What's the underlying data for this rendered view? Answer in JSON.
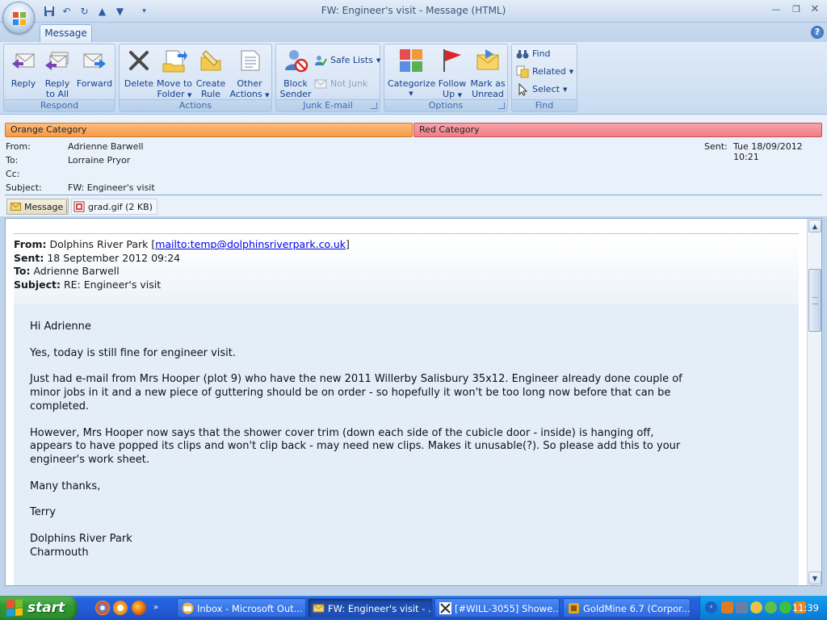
{
  "window": {
    "title": "FW: Engineer's visit - Message (HTML)"
  },
  "tabs": [
    {
      "label": "Message"
    }
  ],
  "ribbon": {
    "respond": {
      "label": "Respond",
      "reply": "Reply",
      "reply_all_1": "Reply",
      "reply_all_2": "to All",
      "forward": "Forward"
    },
    "actions": {
      "label": "Actions",
      "delete": "Delete",
      "move_1": "Move to",
      "move_2": "Folder",
      "rule_1": "Create",
      "rule_2": "Rule",
      "other_1": "Other",
      "other_2": "Actions"
    },
    "junk": {
      "label": "Junk E-mail",
      "block_1": "Block",
      "block_2": "Sender",
      "safe_lists": "Safe Lists",
      "not_junk": "Not Junk"
    },
    "options": {
      "label": "Options",
      "categorize": "Categorize",
      "follow_1": "Follow",
      "follow_2": "Up",
      "mark_1": "Mark as",
      "mark_2": "Unread"
    },
    "find": {
      "label": "Find",
      "find": "Find",
      "related": "Related",
      "select": "Select"
    }
  },
  "categories": [
    {
      "label": "Orange Category",
      "color": "#f59b4a"
    },
    {
      "label": "Red Category",
      "color": "#ef7e86"
    }
  ],
  "header": {
    "from_label": "From:",
    "from": "Adrienne Barwell",
    "to_label": "To:",
    "to": "Lorraine Pryor",
    "cc_label": "Cc:",
    "cc": "",
    "subject_label": "Subject:",
    "subject": "FW: Engineer's visit",
    "sent_label": "Sent:",
    "sent": "Tue 18/09/2012 10:21"
  },
  "attachments": {
    "message_label": "Message",
    "file": "grad.gif (2 KB)"
  },
  "quoted": {
    "from_label": "From:",
    "from_name": "Dolphins River Park",
    "from_link": "mailto:temp@dolphinsriverpark.co.uk",
    "sent_label": "Sent:",
    "sent": "18 September 2012 09:24",
    "to_label": "To:",
    "to": "Adrienne Barwell",
    "subject_label": "Subject:",
    "subject": "RE: Engineer's visit"
  },
  "body": {
    "greeting": "Hi Adrienne",
    "p1": "Yes, today is still fine for engineer visit.",
    "p2": "Just had e-mail from Mrs Hooper (plot 9) who have the new 2011 Willerby Salisbury 35x12. Engineer already done couple of\nminor jobs in it and a new piece of guttering should be on order - so hopefully it won't be too long now before that can be\ncompleted.",
    "p3": "However, Mrs Hooper now says that the shower cover trim (down each side of the cubicle door - inside) is hanging off,\nappears to have popped its clips and won't clip back - may need new clips.  Makes it unusable(?).  So please add this to your\nengineer's work sheet.",
    "thanks": "Many thanks,",
    "name": "Terry",
    "sig_1": "Dolphins River Park",
    "sig_2": "Charmouth"
  },
  "taskbar": {
    "start": "start",
    "tasks": [
      "Inbox - Microsoft Out...",
      "FW: Engineer's visit - ...",
      "[#WILL-3055] Showe...",
      "GoldMine 6.7 (Corpor..."
    ],
    "clock": "11:39"
  }
}
